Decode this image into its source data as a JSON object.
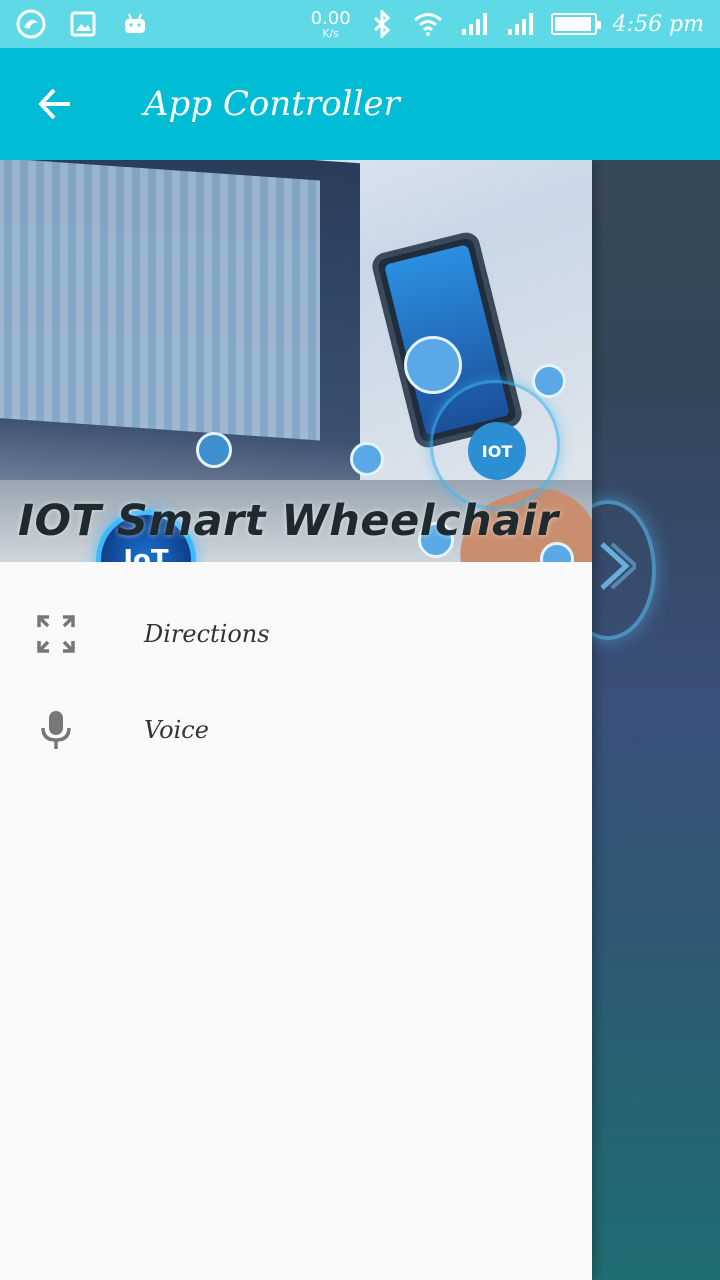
{
  "status_bar": {
    "net_speed": "0.00",
    "net_speed_unit": "K/s",
    "time": "4:56 pm",
    "icons": [
      "app-swirl-icon",
      "image-icon",
      "android-icon",
      "bluetooth-icon",
      "wifi-icon",
      "signal-icon",
      "signal-icon-2",
      "battery-icon"
    ],
    "battery_level": 0.95
  },
  "appbar": {
    "back_icon": "arrow-left-icon",
    "title": "App Controller",
    "color": "#00bcd4"
  },
  "drawer": {
    "header_title": "IOT Smart Wheelchair",
    "header_badge": "IoT",
    "header_badge_2": "IOT",
    "items": [
      {
        "icon": "fullscreen-icon",
        "label": "Directions"
      },
      {
        "icon": "microphone-icon",
        "label": "Voice"
      }
    ]
  }
}
